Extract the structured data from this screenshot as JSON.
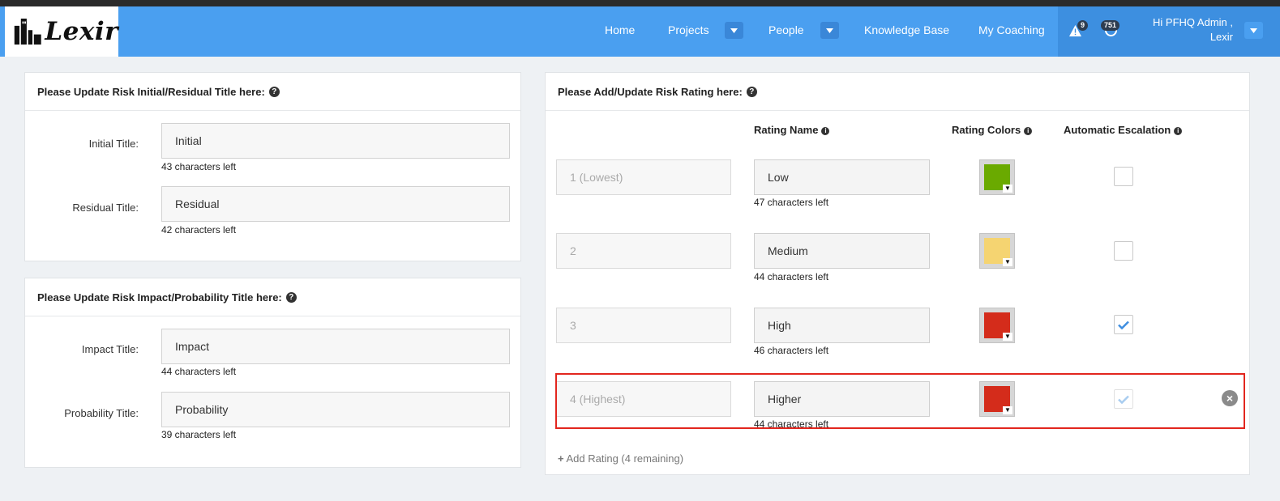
{
  "brand": {
    "name": "Lexir"
  },
  "nav": {
    "home": "Home",
    "projects": "Projects",
    "people": "People",
    "knowledge_base": "Knowledge Base",
    "my_coaching": "My Coaching",
    "alerts_count": "9",
    "messages_count": "751",
    "greeting_line1": "Hi PFHQ Admin ,",
    "greeting_line2": "Lexir"
  },
  "panel_titles": {
    "heading": "Please Update Risk Initial/Residual Title here:",
    "fields": [
      {
        "label": "Initial Title:",
        "value": "Initial",
        "hint": "43 characters left"
      },
      {
        "label": "Residual Title:",
        "value": "Residual",
        "hint": "42 characters left"
      }
    ]
  },
  "panel_impact": {
    "heading": "Please Update Risk Impact/Probability Title here:",
    "fields": [
      {
        "label": "Impact Title:",
        "value": "Impact",
        "hint": "44 characters left"
      },
      {
        "label": "Probability Title:",
        "value": "Probability",
        "hint": "39 characters left"
      }
    ]
  },
  "panel_rating": {
    "heading": "Please Add/Update Risk Rating here:",
    "columns": {
      "name": "Rating Name",
      "colors": "Rating Colors",
      "escalation": "Automatic Escalation"
    },
    "rows": [
      {
        "level": "1 (Lowest)",
        "name": "Low",
        "hint": "47 characters left",
        "color": "#6aaa00",
        "escalate": false
      },
      {
        "level": "2",
        "name": "Medium",
        "hint": "44 characters left",
        "color": "#f5d471",
        "escalate": false
      },
      {
        "level": "3",
        "name": "High",
        "hint": "46 characters left",
        "color": "#d42c1b",
        "escalate": true
      },
      {
        "level": "4 (Highest)",
        "name": "Higher",
        "hint": "44 characters left",
        "color": "#d42c1b",
        "escalate": true
      }
    ],
    "add_label": "Add Rating (4 remaining)"
  }
}
